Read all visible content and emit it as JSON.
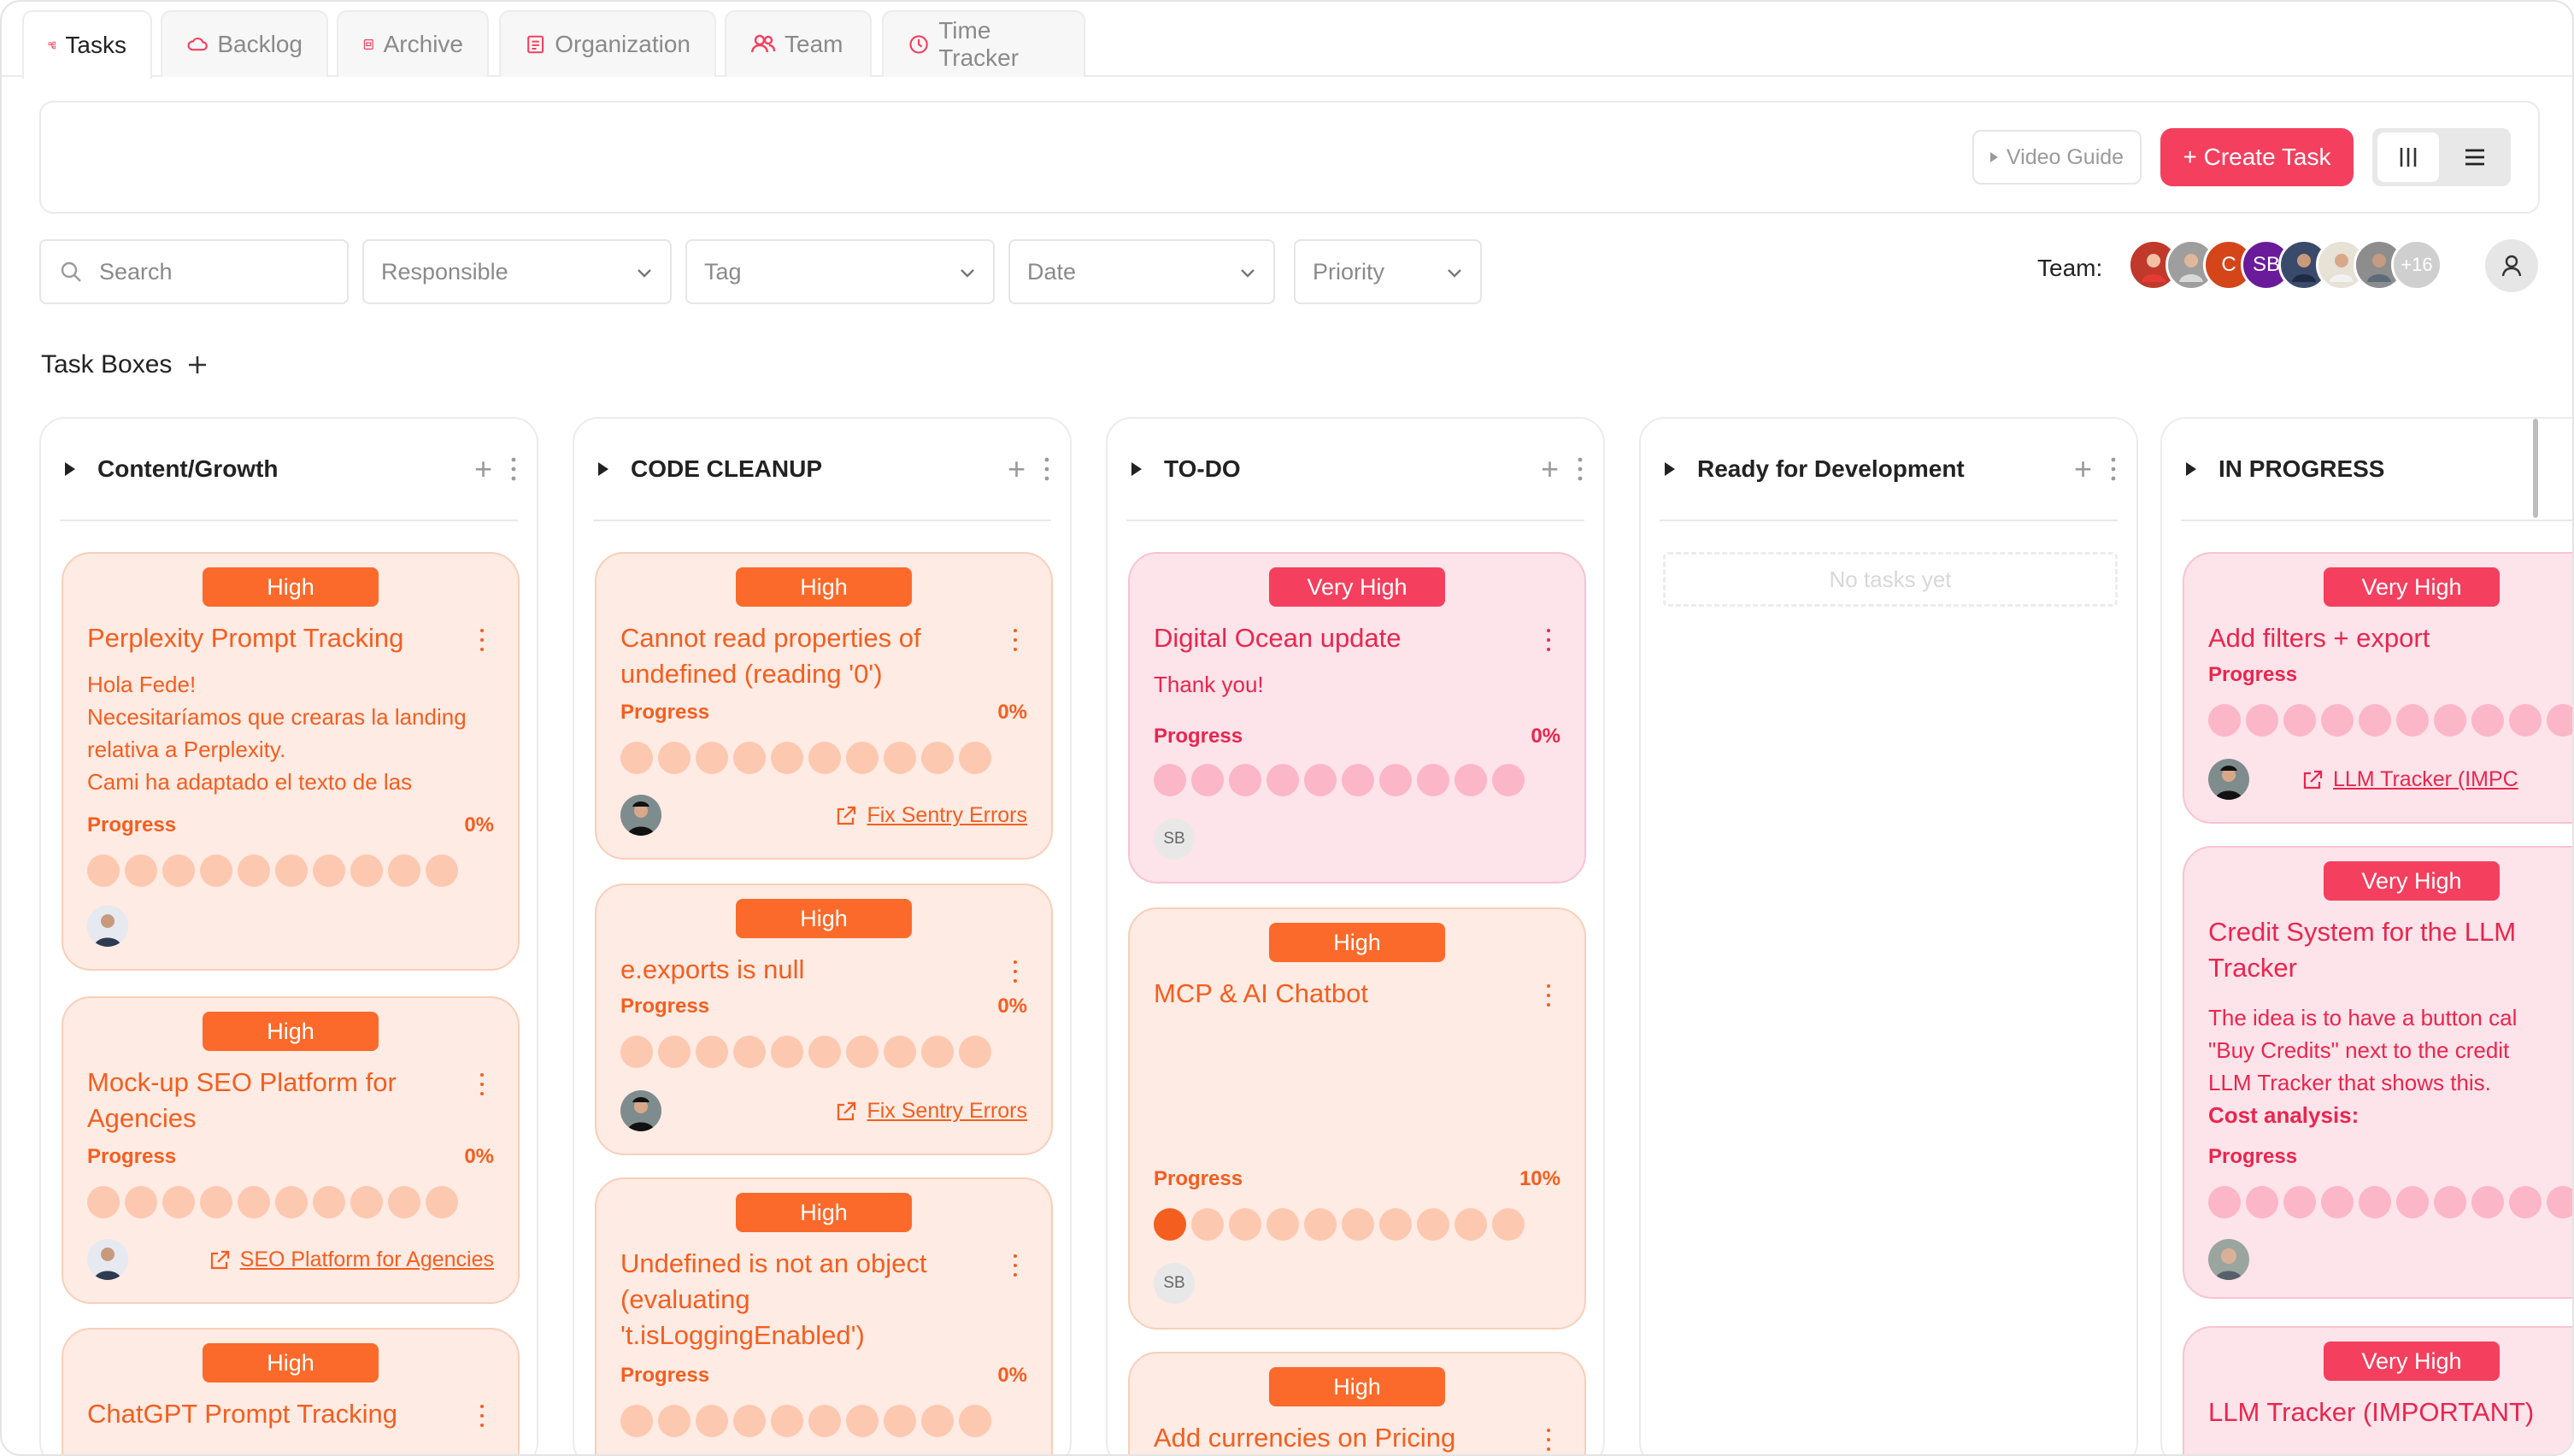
{
  "tabs": [
    {
      "label": "Tasks",
      "icon": "tasks-icon",
      "active": true
    },
    {
      "label": "Backlog",
      "icon": "cloud-icon"
    },
    {
      "label": "Archive",
      "icon": "archive-icon"
    },
    {
      "label": "Organization",
      "icon": "document-icon"
    },
    {
      "label": "Team",
      "icon": "users-icon"
    },
    {
      "label": "Time Tracker",
      "icon": "clock-icon"
    }
  ],
  "toolbar": {
    "video_guide": "Video Guide",
    "create_task": "+ Create Task"
  },
  "filters": {
    "search_placeholder": "Search",
    "responsible": "Responsible",
    "tag": "Tag",
    "date": "Date",
    "priority": "Priority"
  },
  "team": {
    "label": "Team:",
    "initial_c": "C",
    "initial_sb": "SB",
    "more": "+16"
  },
  "task_boxes_title": "Task Boxes",
  "columns": [
    {
      "title": "Content/Growth",
      "cards": [
        {
          "priority": "High",
          "title": "Perplexity Prompt Tracking",
          "desc": "Hola Fede!\nNecesitaríamos que crearas la landing relativa a Perplexity.\nCami ha adaptado el texto de las",
          "progress_label": "Progress",
          "progress": "0%"
        },
        {
          "priority": "High",
          "title": "Mock-up SEO Platform for Agencies",
          "progress_label": "Progress",
          "progress": "0%",
          "link": "SEO Platform for Agencies"
        },
        {
          "priority": "High",
          "title": "ChatGPT Prompt Tracking"
        }
      ]
    },
    {
      "title": "CODE CLEANUP",
      "cards": [
        {
          "priority": "High",
          "title": "Cannot read properties of undefined (reading '0')",
          "progress_label": "Progress",
          "progress": "0%",
          "link": "Fix Sentry Errors"
        },
        {
          "priority": "High",
          "title": "e.exports is null",
          "progress_label": "Progress",
          "progress": "0%",
          "link": "Fix Sentry Errors"
        },
        {
          "priority": "High",
          "title": "Undefined is not an object (evaluating 't.isLoggingEnabled')",
          "progress_label": "Progress",
          "progress": "0%"
        }
      ]
    },
    {
      "title": "TO-DO",
      "cards": [
        {
          "priority": "Very High",
          "title": "Digital Ocean update",
          "desc": "Thank you!",
          "progress_label": "Progress",
          "progress": "0%",
          "assignee": "SB"
        },
        {
          "priority": "High",
          "title": "MCP & AI Chatbot",
          "progress_label": "Progress",
          "progress": "10%",
          "progress_fraction": 0.1,
          "assignee": "SB"
        },
        {
          "priority": "High",
          "title": "Add currencies on Pricing"
        }
      ]
    },
    {
      "title": "Ready for Development",
      "empty": "No tasks yet"
    },
    {
      "title": "IN PROGRESS",
      "cards": [
        {
          "priority": "Very High",
          "title": "Add filters + export",
          "progress_label": "Progress",
          "link": "LLM Tracker (IMPC"
        },
        {
          "priority": "Very High",
          "title": "Credit System for the LLM Tracker",
          "desc": "The idea is to have a button cal\n\"Buy Credits\" next to the credit\nLLM Tracker that shows this.",
          "desc_bold": "Cost analysis:",
          "progress_label": "Progress"
        },
        {
          "priority": "Very High",
          "title": "LLM Tracker (IMPORTANT)"
        }
      ]
    }
  ],
  "colors": {
    "accent": "#f43f5e",
    "high": "#fb6a2a",
    "very_high": "#f43f5e",
    "orange_text": "#f45e1e",
    "pink_text": "#e8264e"
  }
}
